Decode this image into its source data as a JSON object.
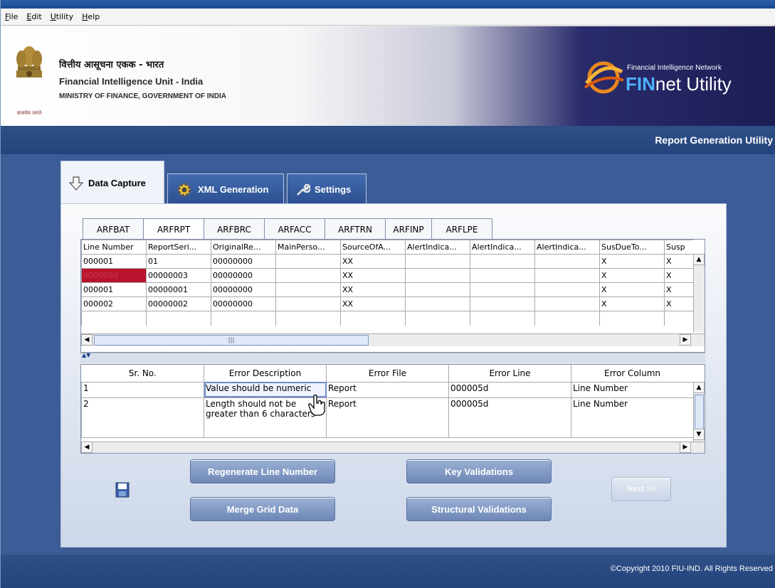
{
  "menu": [
    {
      "label": "File",
      "mnemonic": "F"
    },
    {
      "label": "Edit",
      "mnemonic": "E"
    },
    {
      "label": "Utility",
      "mnemonic": "U"
    },
    {
      "label": "Help",
      "mnemonic": "H"
    }
  ],
  "header": {
    "hindi_title": "वित्तीय आसूचना एकक - भारत",
    "english_title": "Financial Intelligence Unit - India",
    "ministry": "MINISTRY OF FINANCE, GOVERNMENT OF INDIA",
    "emblem_caption": "सत्यमेव जयते",
    "finnet_subtitle": "Financial Intelligence Network",
    "finnet_fin": "FIN",
    "finnet_rest": "net Utility"
  },
  "subbar": {
    "label": "Report Generation Utility"
  },
  "main_tabs": [
    {
      "label": "Data Capture",
      "icon": "down-arrow-icon",
      "active": true
    },
    {
      "label": "XML Generation",
      "icon": "gear-icon",
      "active": false
    },
    {
      "label": "Settings",
      "icon": "wrench-icon",
      "active": false
    }
  ],
  "sub_tabs": [
    {
      "label": "ARFBAT",
      "active": false
    },
    {
      "label": "ARFRPT",
      "active": true
    },
    {
      "label": "ARFBRC",
      "active": false
    },
    {
      "label": "ARFACC",
      "active": false
    },
    {
      "label": "ARFTRN",
      "active": false
    },
    {
      "label": "ARFINP",
      "active": false
    },
    {
      "label": "ARFLPE",
      "active": false
    }
  ],
  "report_grid": {
    "columns": [
      "Line Number",
      "ReportSeri...",
      "OriginalRe...",
      "MainPerso...",
      "SourceOfA...",
      "AlertIndica...",
      "AlertIndica...",
      "AlertIndica...",
      "SusDueTo...",
      "Susp"
    ],
    "rows": [
      [
        "000001",
        "01",
        "00000000",
        "",
        "XX",
        "",
        "",
        "",
        "X",
        "X"
      ],
      [
        "000005d",
        "00000003",
        "00000000",
        "",
        "XX",
        "",
        "",
        "",
        "X",
        "X"
      ],
      [
        "000001",
        "00000001",
        "00000000",
        "",
        "XX",
        "",
        "",
        "",
        "X",
        "X"
      ],
      [
        "000002",
        "00000002",
        "00000000",
        "",
        "XX",
        "",
        "",
        "",
        "X",
        "X"
      ]
    ],
    "error_row_index": 1
  },
  "error_grid": {
    "columns": [
      "Sr. No.",
      "Error Description",
      "Error File",
      "Error Line",
      "Error Column"
    ],
    "rows": [
      [
        "1",
        "Value should be numeric",
        "Report",
        "000005d",
        "Line Number"
      ],
      [
        "2",
        "Length should not be greater than 6 characters",
        "Report",
        "000005d",
        "Line Number"
      ]
    ]
  },
  "buttons": {
    "regenerate": "Regenerate Line Number",
    "merge": "Merge Grid Data",
    "key_validations": "Key Validations",
    "structural_validations": "Structural Validations",
    "next": "Next >>"
  },
  "footer": {
    "copyright": "©Copyright 2010 FIU-IND. All Rights Reserved"
  },
  "colors": {
    "header_dark": "#1c1d55",
    "bar_blue": "#2f4f87",
    "error_red": "#b8122c",
    "button_blue": "#6e87b6"
  }
}
